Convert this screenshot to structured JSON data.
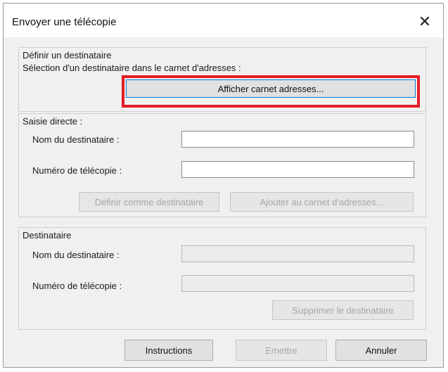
{
  "window": {
    "title": "Envoyer une télécopie",
    "close_icon": "close-icon"
  },
  "define_recipient": {
    "heading": "Définir un destinataire",
    "subheading": "Sélection d'un destinataire dans le carnet d'adresses :",
    "show_addressbook_label": "Afficher carnet adresses..."
  },
  "direct_entry": {
    "heading": "Saisie directe :",
    "name_label": "Nom du destinataire :",
    "name_value": "",
    "fax_label": "Numéro de télécopie :",
    "fax_value": "",
    "set_recipient_label": "Définir comme destinataire",
    "add_to_addressbook_label": "Ajouter au carnet d'adresses..."
  },
  "recipient": {
    "heading": "Destinataire",
    "name_label": "Nom du destinataire :",
    "name_value": "",
    "fax_label": "Numéro de télécopie :",
    "fax_value": "",
    "delete_label": "Supprimer le destinataire"
  },
  "footer": {
    "instructions_label": "Instructions",
    "send_label": "Emettre",
    "cancel_label": "Annuler"
  },
  "colors": {
    "highlight": "#e31d24",
    "dialog_bg": "#f0f0f0"
  }
}
